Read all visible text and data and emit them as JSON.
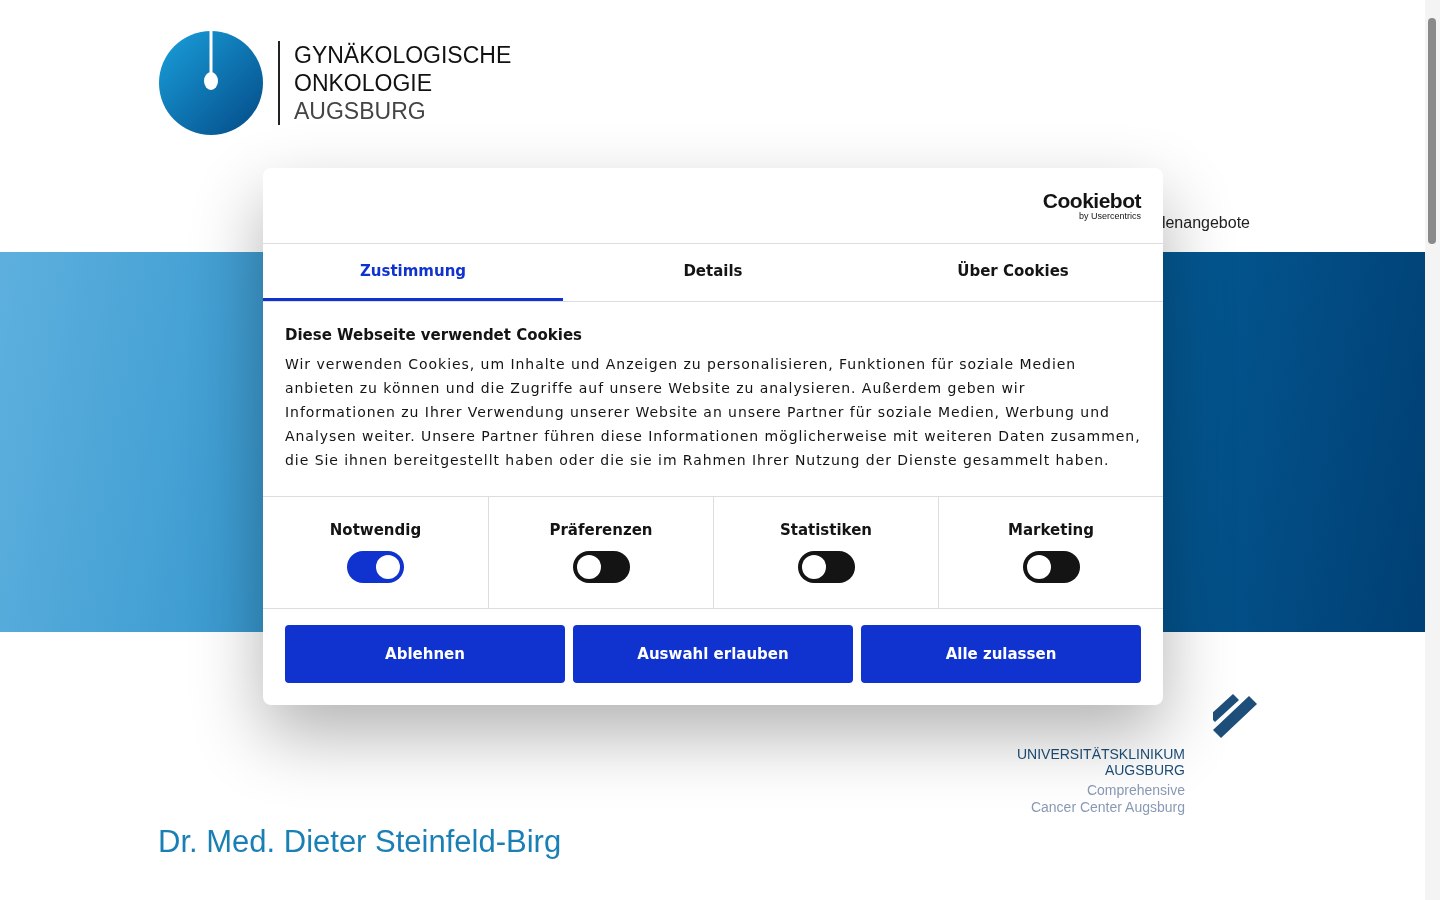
{
  "site_logo": {
    "lines": [
      "GYNÄKOLOGISCHE",
      "ONKOLOGIE",
      "AUGSBURG"
    ]
  },
  "nav": {
    "partial_item": "lenangebote"
  },
  "partner_logo": {
    "lines": [
      "UNIVERSITÄTSKLINIKUM",
      "AUGSBURG"
    ],
    "sub_lines": [
      "Comprehensive",
      "Cancer Center Augsburg"
    ]
  },
  "heading": "Dr. Med. Dieter Steinfeld-Birg",
  "cookie_dialog": {
    "brand": "Cookiebot",
    "brand_sub": "by Usercentrics",
    "tabs": [
      {
        "label": "Zustimmung",
        "selected": true
      },
      {
        "label": "Details",
        "selected": false
      },
      {
        "label": "Über Cookies",
        "selected": false
      }
    ],
    "title": "Diese Webseite verwendet Cookies",
    "text": "Wir verwenden Cookies, um Inhalte und Anzeigen zu personalisieren, Funktionen für soziale Medien anbieten zu können und die Zugriffe auf unsere Website zu analysieren. Außerdem geben wir Informationen zu Ihrer Verwendung unserer Website an unsere Partner für soziale Medien, Werbung und Analysen weiter. Unsere Partner führen diese Informationen möglicherweise mit weiteren Daten zusammen, die Sie ihnen bereitgestellt haben oder die sie im Rahmen Ihrer Nutzung der Dienste gesammelt haben.",
    "categories": [
      {
        "label": "Notwendig",
        "on": true
      },
      {
        "label": "Präferenzen",
        "on": false
      },
      {
        "label": "Statistiken",
        "on": false
      },
      {
        "label": "Marketing",
        "on": false
      }
    ],
    "buttons": [
      "Ablehnen",
      "Auswahl erlauben",
      "Alle zulassen"
    ]
  }
}
